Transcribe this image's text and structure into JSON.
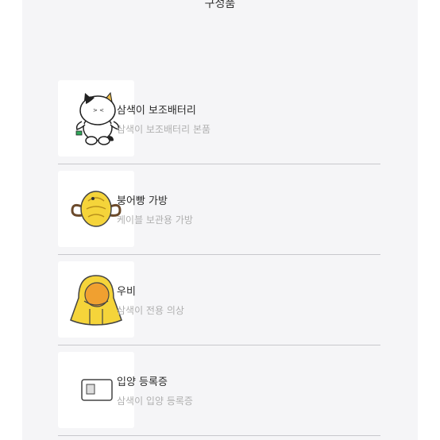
{
  "section": {
    "title": "구성품"
  },
  "items": [
    {
      "name": "삼색이 보조배터리",
      "desc": "삼색이 보조배터리 본품",
      "icon": "calico-cat-battery-icon"
    },
    {
      "name": "붕어빵 가방",
      "desc": "케이블 보관용 가방",
      "icon": "fish-bread-bag-icon"
    },
    {
      "name": "우비",
      "desc": "삼색이 전용 의상",
      "icon": "raincoat-icon"
    },
    {
      "name": "입양 등록증",
      "desc": "삼색이 입양 등록증",
      "icon": "id-card-icon"
    }
  ],
  "colors": {
    "background": "#f5f5f7",
    "accent_yellow": "#f5d43a",
    "divider": "#c8c8cc"
  }
}
